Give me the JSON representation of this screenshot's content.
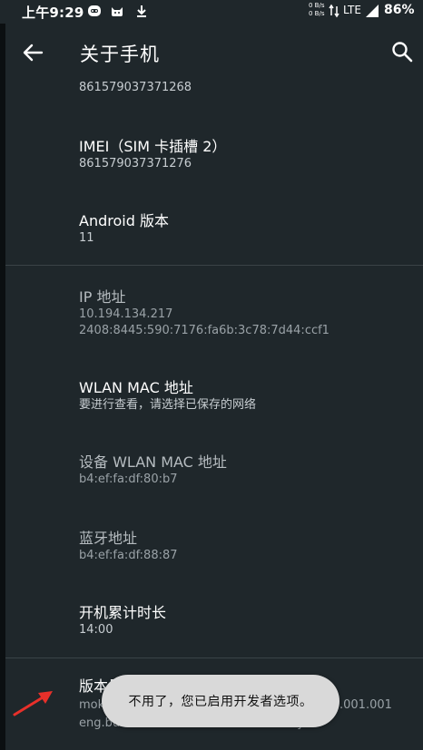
{
  "status_bar": {
    "time": "上午9:29",
    "net_speed_up": "0 B/s",
    "net_speed_down": "0 B/s",
    "network": "LTE",
    "battery": "86%"
  },
  "app_bar": {
    "title": "关于手机"
  },
  "items": [
    {
      "title": "",
      "value": "861579037371268"
    },
    {
      "title": "IMEI（SIM 卡插槽 2）",
      "value": "861579037371276"
    },
    {
      "title": "Android 版本",
      "value": "11"
    },
    {
      "title": "IP 地址",
      "value": "10.194.134.217",
      "value2": "2408:8445:590:7176:fa6b:3c78:7d44:ccf1"
    },
    {
      "title": "WLAN MAC 地址",
      "value": "要进行查看，请选择已保存的网络"
    },
    {
      "title": "设备 WLAN MAC 地址",
      "value": "b4:ef:fa:df:80:b7"
    },
    {
      "title": "蓝牙地址",
      "value": "b4:ef:fa:df:88:87"
    },
    {
      "title": "开机累计时长",
      "value": "14:00"
    },
    {
      "title": "版本号",
      "value": "moke",
      "value_tail": ".001.001",
      "value2": "eng.buildb.20230106.192529 dev-keys"
    }
  ],
  "toast": {
    "message": "不用了，您已启用开发者选项。"
  },
  "colors": {
    "background": "#1f272b",
    "toast_bg": "#d9d9d9",
    "annotation_arrow": "#e8302a"
  }
}
